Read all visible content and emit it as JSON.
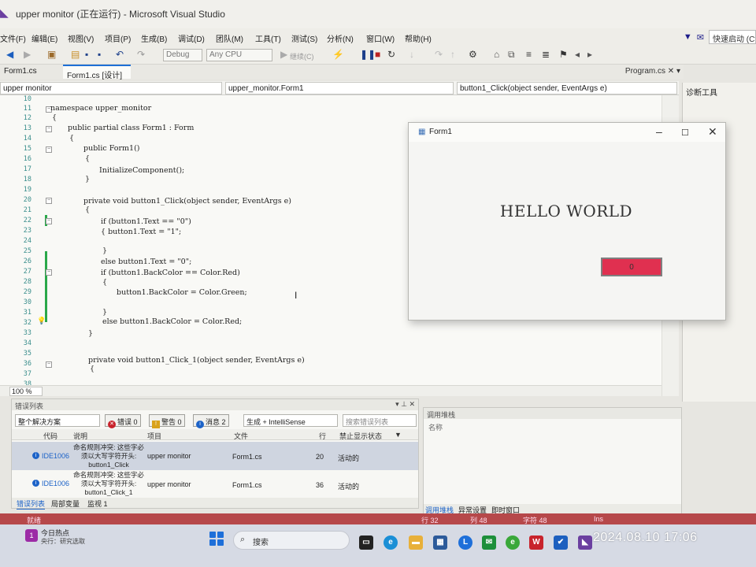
{
  "window": {
    "title": "upper monitor (正在运行) - Microsoft Visual Studio"
  },
  "menu": [
    "文件(F)",
    "编辑(E)",
    "视图(V)",
    "项目(P)",
    "生成(B)",
    "调试(D)",
    "团队(M)",
    "工具(T)",
    "测试(S)",
    "分析(N)",
    "窗口(W)",
    "帮助(H)"
  ],
  "quick_launch": "快速启动 (Ctrl",
  "toolbar": {
    "config": "Debug",
    "platform": "Any CPU",
    "continue_label": "继续(C)"
  },
  "doc_tabs": {
    "left": "Form1.cs",
    "active": "Form1.cs [设计]",
    "right": "Program.cs"
  },
  "nav": {
    "project": "upper monitor",
    "class": "upper_monitor.Form1",
    "member": "button1_Click(object sender, EventArgs e)"
  },
  "diag_title": "诊断工具",
  "code_lines": [
    {
      "no": "10",
      "text": ""
    },
    {
      "no": "11",
      "text": "namespace upper_monitor"
    },
    {
      "no": "12",
      "text": "{"
    },
    {
      "no": "13",
      "text": "public partial class Form1 : Form"
    },
    {
      "no": "14",
      "text": "{"
    },
    {
      "no": "15",
      "text": "public Form1()"
    },
    {
      "no": "16",
      "text": "{"
    },
    {
      "no": "17",
      "text": "InitializeComponent();"
    },
    {
      "no": "18",
      "text": "}"
    },
    {
      "no": "19",
      "text": ""
    },
    {
      "no": "20",
      "text": "private void button1_Click(object sender, EventArgs e)"
    },
    {
      "no": "21",
      "text": "{"
    },
    {
      "no": "22",
      "text": "if (button1.Text == \"0\")"
    },
    {
      "no": "23",
      "text": "{ button1.Text = \"1\";"
    },
    {
      "no": "24",
      "text": ""
    },
    {
      "no": "25",
      "text": "}"
    },
    {
      "no": "26",
      "text": "else button1.Text = \"0\";"
    },
    {
      "no": "27",
      "text": "if (button1.BackColor == Color.Red)"
    },
    {
      "no": "28",
      "text": "{"
    },
    {
      "no": "29",
      "text": "button1.BackColor = Color.Green;"
    },
    {
      "no": "30",
      "text": ""
    },
    {
      "no": "31",
      "text": "}"
    },
    {
      "no": "32",
      "text": "else button1.BackColor = Color.Red;"
    },
    {
      "no": "33",
      "text": "}"
    },
    {
      "no": "34",
      "text": ""
    },
    {
      "no": "35",
      "text": ""
    },
    {
      "no": "36",
      "text": "private void button1_Click_1(object sender, EventArgs e)"
    },
    {
      "no": "37",
      "text": "{"
    },
    {
      "no": "38",
      "text": ""
    }
  ],
  "zoom": "100 %",
  "form1": {
    "title": "Form1",
    "label": "HELLO WORLD",
    "button_text": "0",
    "button_color": "#e03050"
  },
  "error_list": {
    "title": "错误列表",
    "scope": "整个解决方案",
    "errors_btn": "错误 0",
    "warnings_btn": "警告 0",
    "messages_btn": "消息 2",
    "source_filter": "生成 + IntelliSense",
    "search_placeholder": "搜索错误列表",
    "columns": [
      "代码",
      "说明",
      "项目",
      "文件",
      "行",
      "禁止显示状态"
    ],
    "rows": [
      {
        "code": "IDE1006",
        "desc": "命名规则冲突: 这些字必须以大写字符开头: button1_Click",
        "project": "upper monitor",
        "file": "Form1.cs",
        "line": "20",
        "state": "活动的"
      },
      {
        "code": "IDE1006",
        "desc": "命名规则冲突: 这些字必须以大写字符开头: button1_Click_1",
        "project": "upper monitor",
        "file": "Form1.cs",
        "line": "36",
        "state": "活动的"
      }
    ],
    "bottom_tabs": [
      "错误列表",
      "局部变量",
      "监视 1"
    ]
  },
  "call_stack": {
    "title": "调用堆栈",
    "column": "名称",
    "bottom_tabs": [
      "调用堆栈",
      "异常设置",
      "即时窗口"
    ]
  },
  "status": {
    "left": "就绪",
    "line": "行 32",
    "col": "列 48",
    "char": "字符 48",
    "mode": "Ins"
  },
  "taskbar": {
    "weather_title": "今日热点",
    "weather_sub": "央行：研究选取",
    "search": "搜索",
    "datetime": "2024.08.10  17:06"
  }
}
